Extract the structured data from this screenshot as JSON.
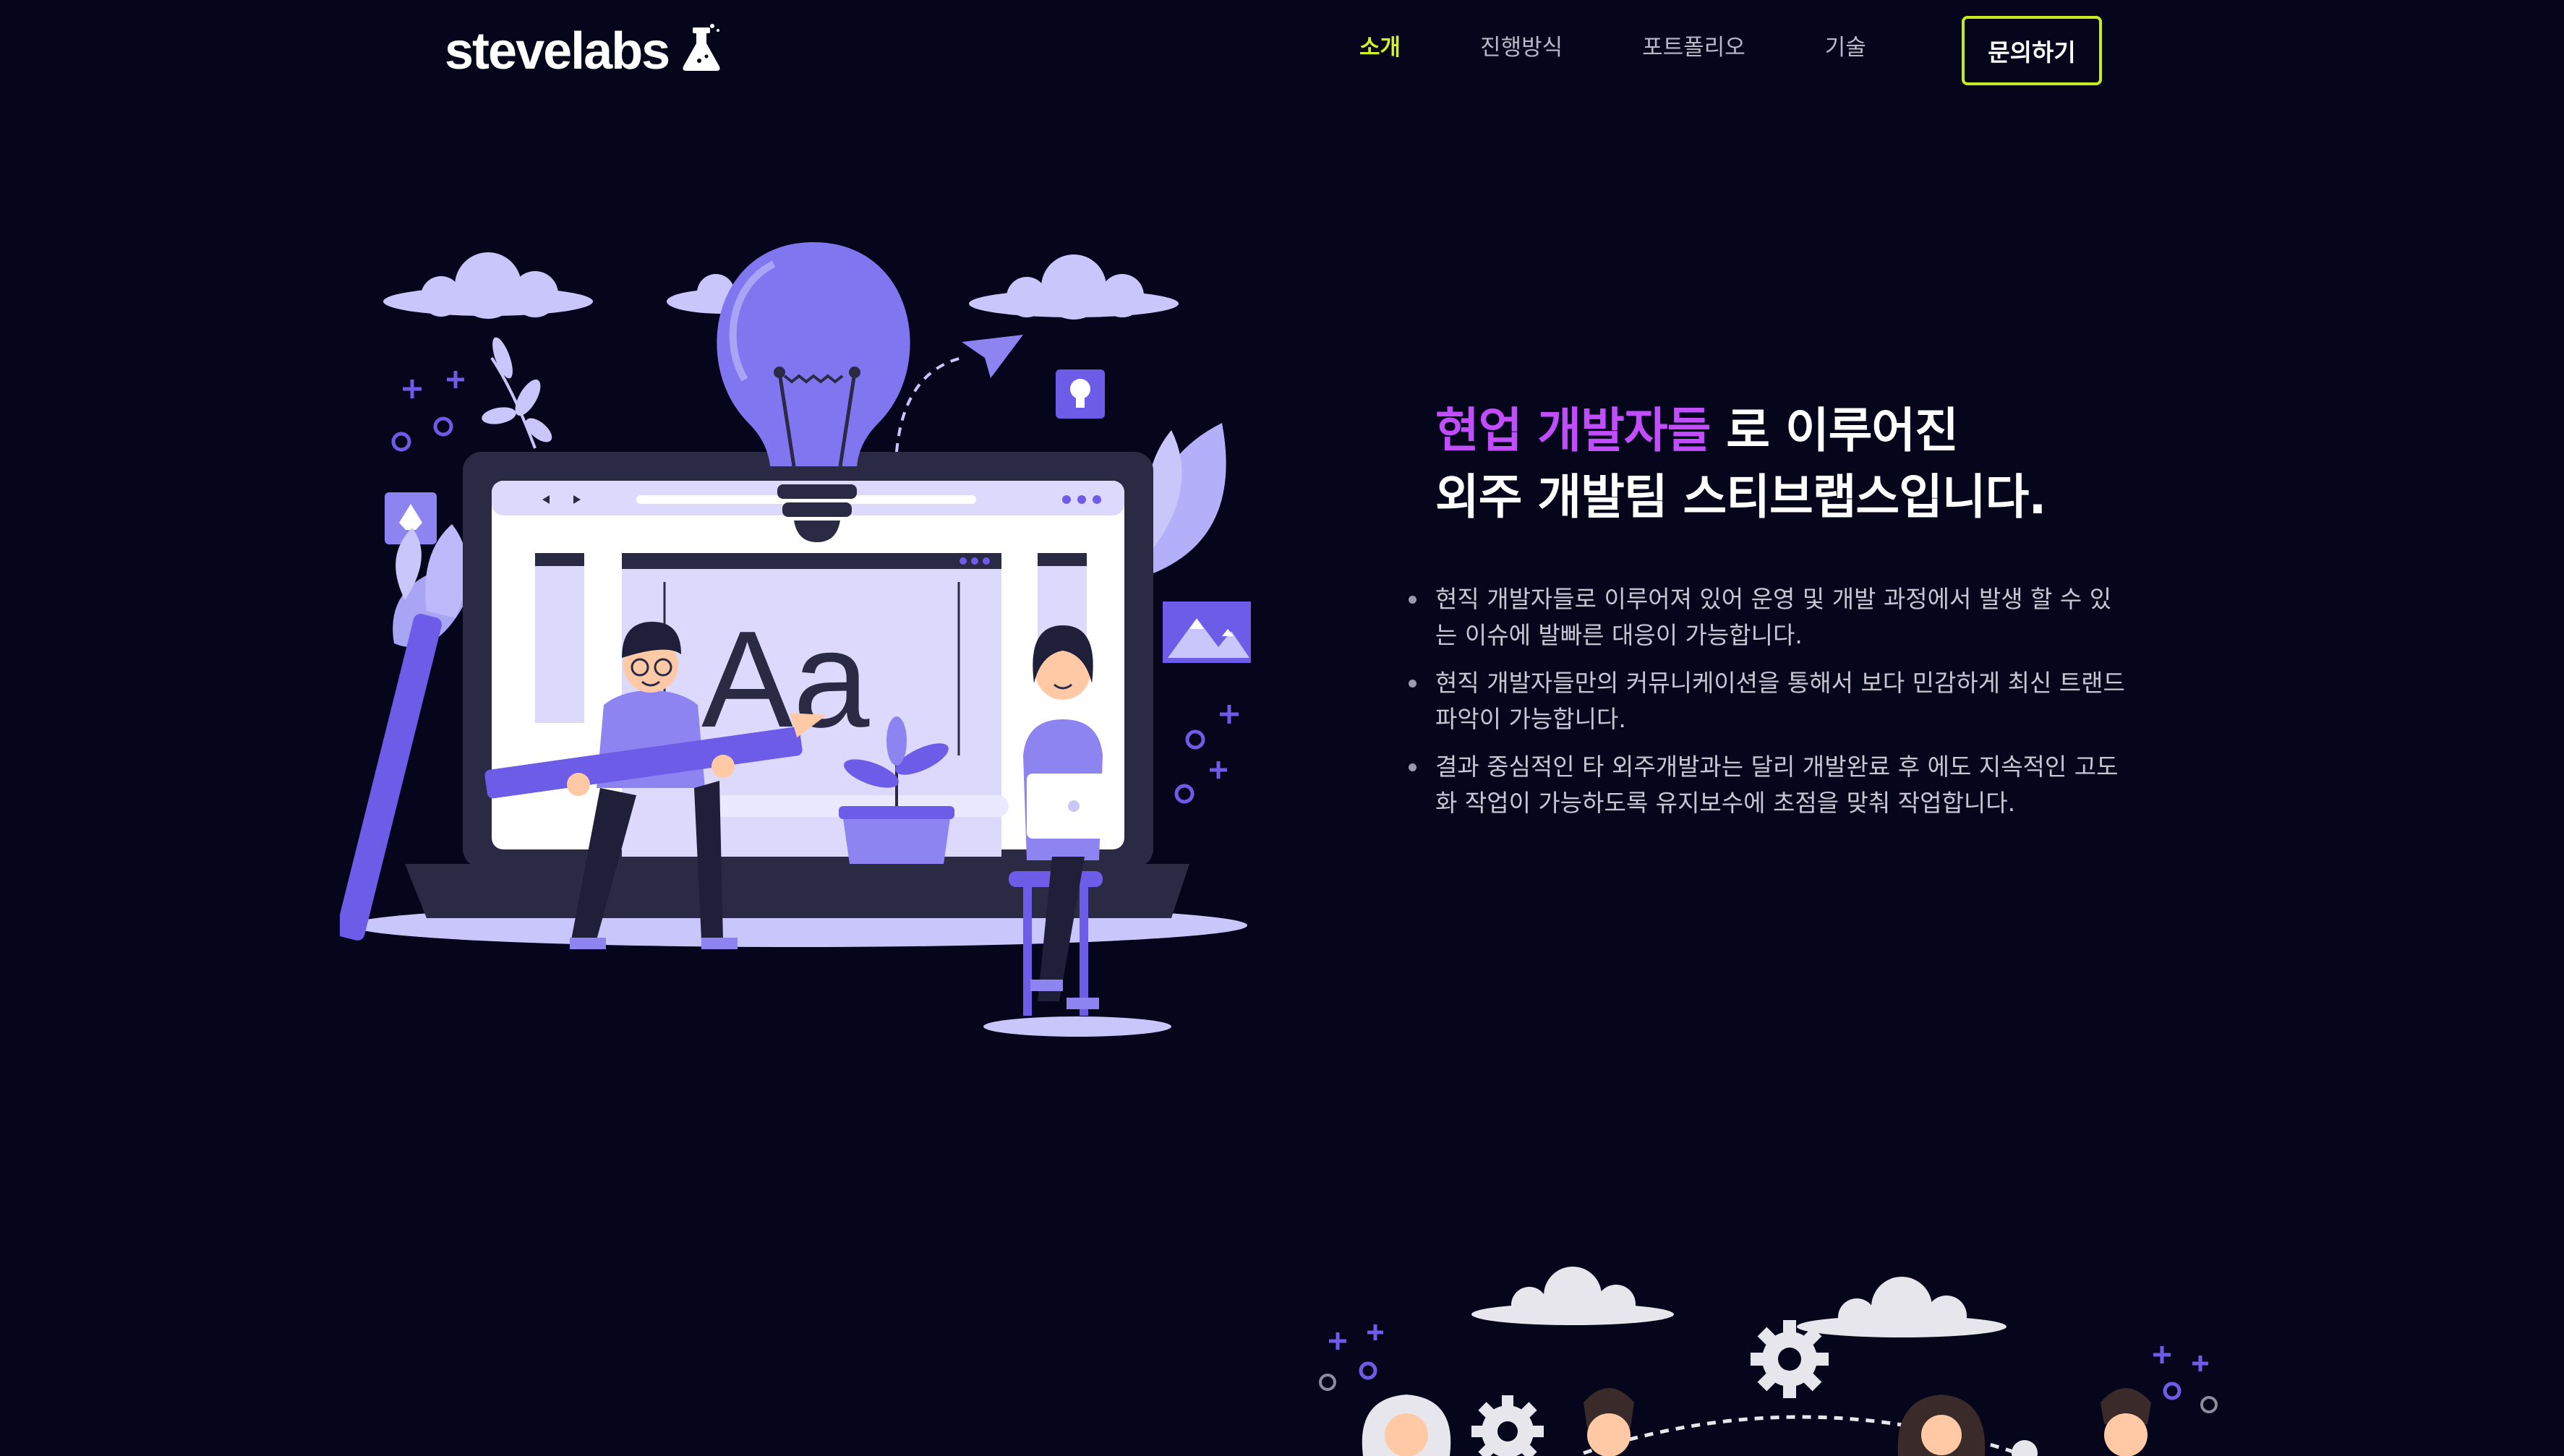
{
  "brand": {
    "name": "stevelabs",
    "icon": "flask-icon"
  },
  "nav": {
    "items": [
      {
        "label": "소개",
        "active": true
      },
      {
        "label": "진행방식",
        "active": false
      },
      {
        "label": "포트폴리오",
        "active": false
      },
      {
        "label": "기술",
        "active": false
      }
    ],
    "cta_label": "문의하기"
  },
  "hero": {
    "headline_accent": "현업 개발자들",
    "headline_rest": " 로 이루어진",
    "headline_line2": "외주 개발팀 스티브랩스입니다.",
    "bullets": [
      "현직 개발자들로 이루어져 있어 운영 및 개발 과정에서 발생 할 수 있는 이슈에 발빠른 대응이 가능합니다.",
      "현직 개발자들만의 커뮤니케이션을 통해서 보다 민감하게 최신 트랜드 파악이 가능합니다.",
      "결과 중심적인 타 외주개발과는 달리 개발완료 후 에도 지속적인 고도화 작업이 가능하도록 유지보수에 초점을 맞춰 작업합니다."
    ],
    "illustration_text": "Aa"
  },
  "colors": {
    "background": "#05051c",
    "accent": "#c24dff",
    "active_nav": "#d4f21d",
    "cta_border": "#c6ed22",
    "purple": "#6c5ce7",
    "lavender": "#c9c6fb"
  }
}
